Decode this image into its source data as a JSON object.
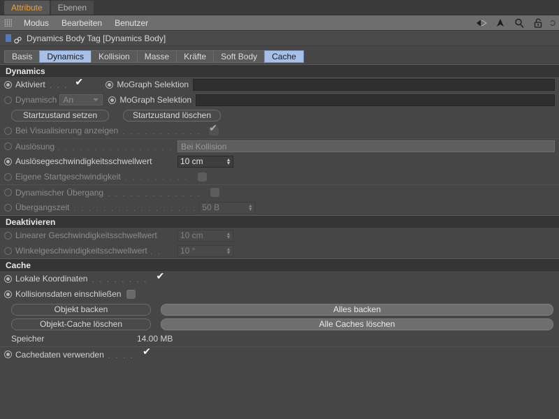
{
  "window_tabs": [
    {
      "label": "Attribute",
      "active": true
    },
    {
      "label": "Ebenen",
      "active": false
    }
  ],
  "menubar": {
    "items": [
      "Modus",
      "Bearbeiten",
      "Benutzer"
    ],
    "icons": [
      "back-arrow-icon",
      "up-arrow-icon",
      "search-icon",
      "lock-icon",
      "history-icon"
    ]
  },
  "object": {
    "title": "Dynamics Body Tag [Dynamics Body]",
    "icon": "dynamics-body-tag-icon"
  },
  "prop_tabs": [
    {
      "label": "Basis",
      "selected": false
    },
    {
      "label": "Dynamics",
      "selected": true
    },
    {
      "label": "Kollision",
      "selected": false
    },
    {
      "label": "Masse",
      "selected": false
    },
    {
      "label": "Kräfte",
      "selected": false
    },
    {
      "label": "Soft Body",
      "selected": false
    },
    {
      "label": "Cache",
      "selected": true
    }
  ],
  "sections": {
    "dynamics": {
      "header": "Dynamics",
      "aktiviert_label": "Aktiviert",
      "aktiviert_leader": ". . .",
      "mograph_selektion_1": "MoGraph Selektion",
      "mograph_selektion_1_value": "",
      "dynamisch_label": "Dynamisch",
      "dynamisch_value": "An",
      "mograph_selektion_2": "MoGraph Selektion",
      "mograph_selektion_2_value": "",
      "btn_startzustand_setzen": "Startzustand setzen",
      "btn_startzustand_loeschen": "Startzustand löschen",
      "bei_visualisierung_label": "Bei Visualisierung anzeigen",
      "bei_visualisierung_leader": ". . . . . . . . . . .",
      "ausloesung_label": "Auslösung",
      "ausloesung_leader": ". . . . . . . . . . . . . . . . . . . .",
      "ausloesung_value": "Bei Kollision",
      "schwellwert_label": "Auslösegeschwindigkeitsschwellwert",
      "schwellwert_value": "10 cm",
      "eigene_start_label": "Eigene Startgeschwindigkeit",
      "eigene_start_leader": ". . . . . . . . .",
      "dyn_uebergang_label": "Dynamischer Übergang",
      "dyn_uebergang_leader": ". . . . . . . . . . . . .",
      "uebergangszeit_label": "Übergangszeit",
      "uebergangszeit_leader": ". . . . . . . . . . . . . . . . .",
      "uebergangszeit_value": "50 B"
    },
    "deaktivieren": {
      "header": "Deaktivieren",
      "linear_label": "Linearer Geschwindigkeitsschwellwert",
      "linear_value": "10 cm",
      "winkel_label": "Winkelgeschwindigkeitsschwellwert",
      "winkel_leader": ". .",
      "winkel_value": "10 °"
    },
    "cache": {
      "header": "Cache",
      "lokale_label": "Lokale Koordinaten",
      "lokale_leader": ". . . . . . . .",
      "kollisionsdaten_label": "Kollisionsdaten einschließen",
      "btn_objekt_backen": "Objekt backen",
      "btn_alles_backen": "Alles backen",
      "btn_objekt_cache_loeschen": "Objekt-Cache löschen",
      "btn_alle_caches_loeschen": "Alle Caches löschen",
      "speicher_label": "Speicher",
      "speicher_value": "14.00 MB",
      "cachedaten_label": "Cachedaten verwenden",
      "cachedaten_leader": ". . . ."
    }
  },
  "colors": {
    "background": "#464646",
    "section_header": "#353535",
    "tab_selected": "#a8c0e8",
    "window_tab_active_text": "#f0a030",
    "menubar": "#6e6e6e"
  }
}
